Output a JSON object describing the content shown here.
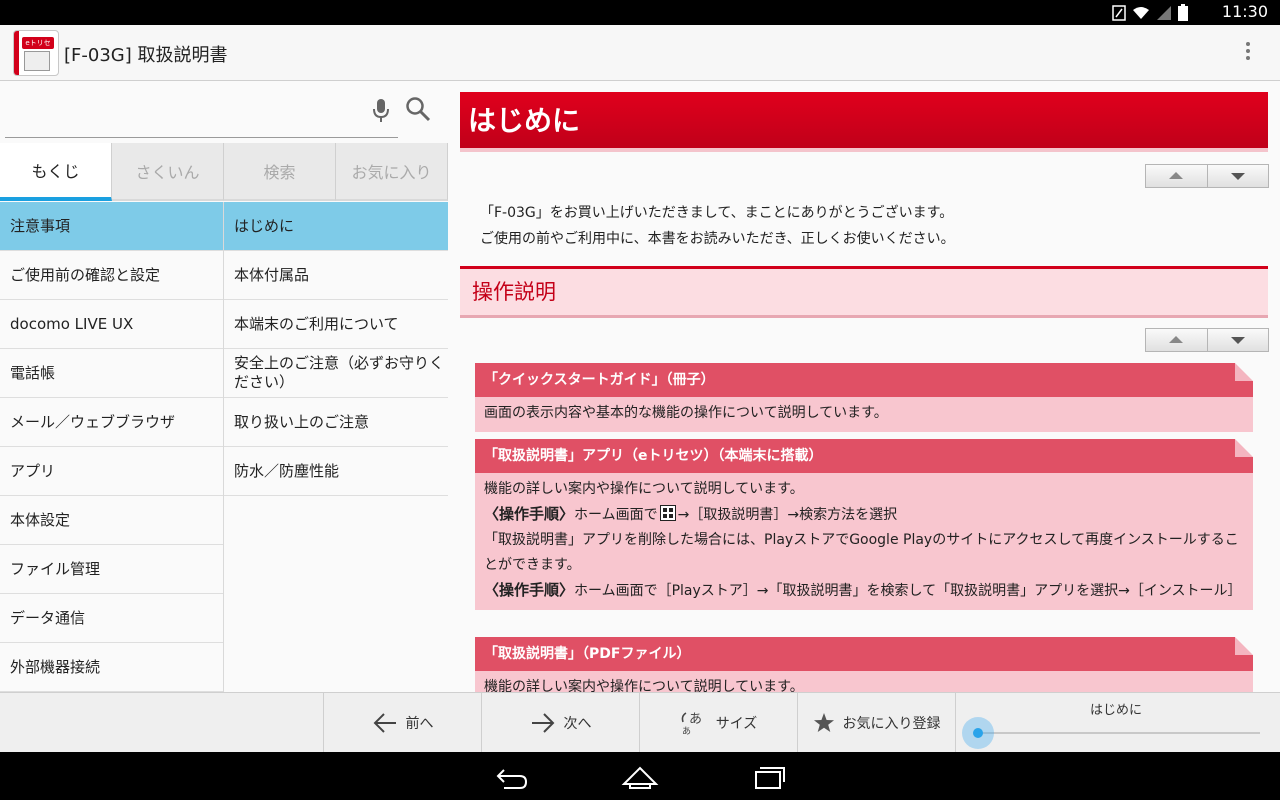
{
  "status_bar": {
    "time": "11:30"
  },
  "app": {
    "title": "[F-03G] 取扱説明書",
    "logo_text": "eトリセツ"
  },
  "search": {
    "value": "",
    "placeholder": ""
  },
  "tabs": [
    {
      "label": "もくじ",
      "active": true
    },
    {
      "label": "さくいん",
      "active": false
    },
    {
      "label": "検索",
      "active": false
    },
    {
      "label": "お気に入り",
      "active": false
    }
  ],
  "categories": [
    "注意事項",
    "ご使用前の確認と設定",
    "docomo LIVE UX",
    "電話帳",
    "メール／ウェブブラウザ",
    "アプリ",
    "本体設定",
    "ファイル管理",
    "データ通信",
    "外部機器接続"
  ],
  "subitems": [
    "はじめに",
    "本体付属品",
    "本端末のご利用について",
    "安全上のご注意（必ずお守りください）",
    "取り扱い上のご注意",
    "防水／防塵性能"
  ],
  "content": {
    "heading": "はじめに",
    "intro": [
      "「F-03G」をお買い上げいただきまして、まことにありがとうございます。",
      "ご使用の前やご利用中に、本書をお読みいただき、正しくお使いください。"
    ],
    "section_title": "操作説明",
    "card1": {
      "title": "「クイックスタートガイド」（冊子）",
      "text": "画面の表示内容や基本的な機能の操作について説明しています。"
    },
    "card2": {
      "title": "「取扱説明書」アプリ（eトリセツ）（本端末に搭載）",
      "line1": "機能の詳しい案内や操作について説明しています。",
      "step_label": "〈操作手順〉",
      "step1_a": "ホーム画面で",
      "step1_b": "→［取扱説明書］→検索方法を選択",
      "line3": "「取扱説明書」アプリを削除した場合には、PlayストアでGoogle Playのサイトにアクセスして再度インストールすることができます。",
      "step2": "ホーム画面で［Playストア］→「取扱説明書」を検索して「取扱説明書」アプリを選択→［インストール］"
    },
    "card3": {
      "title": "「取扱説明書」（PDFファイル）",
      "text": "機能の詳しい案内や操作について説明しています。"
    }
  },
  "bottom_bar": {
    "prev": "前へ",
    "next": "次へ",
    "size": "サイズ",
    "favorite": "お気に入り登録",
    "slider_title": "はじめに",
    "slider_position": 0.0
  },
  "colors": {
    "brand_red": "#d2001a",
    "selected_row": "#7ecbe8",
    "tab_indicator": "#1aa0e0",
    "card_header": "#e05065",
    "card_body": "#f8c6cf"
  }
}
